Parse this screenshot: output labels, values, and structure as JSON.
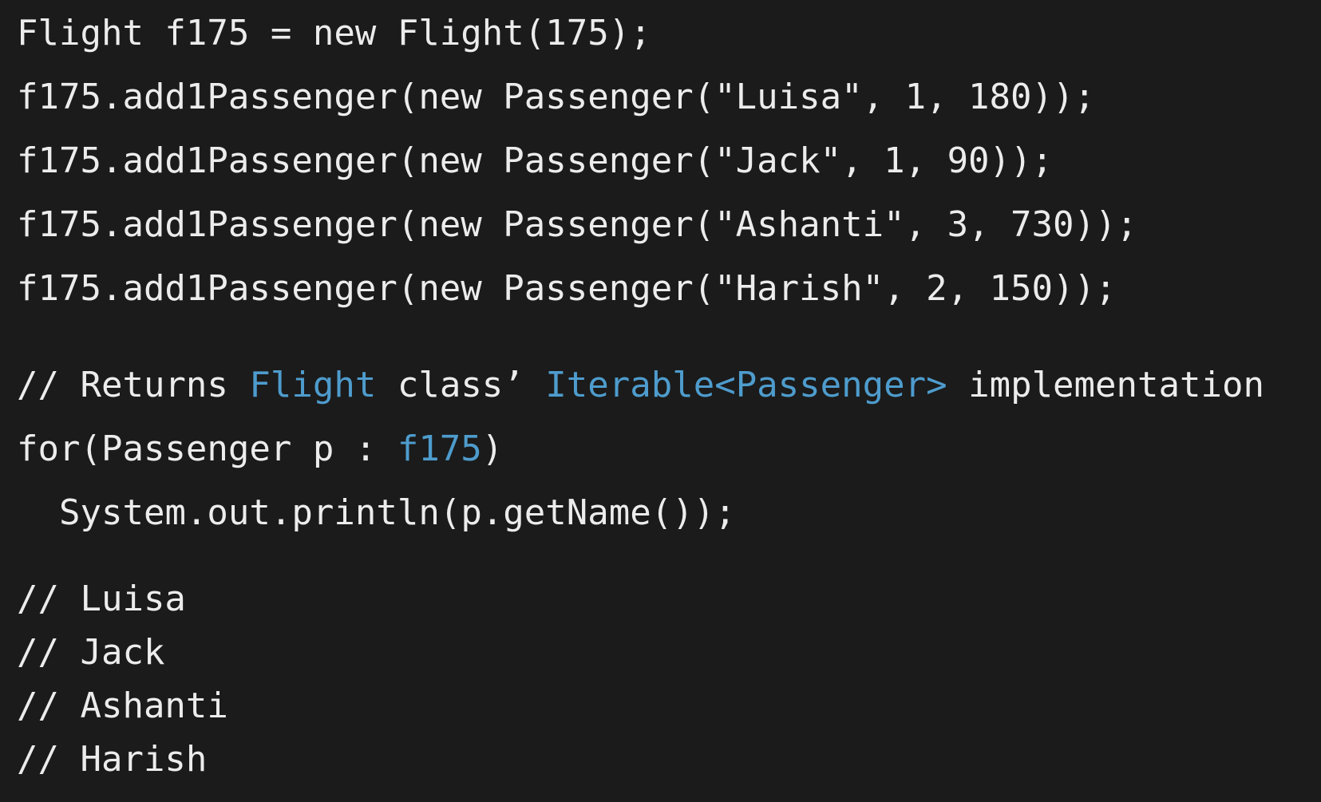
{
  "colors": {
    "background": "#1b1b1b",
    "text": "#ececec",
    "highlight": "#4e9ccd"
  },
  "code": {
    "line1": "Flight f175 = new Flight(175);",
    "line2": "f175.add1Passenger(new Passenger(\"Luisa\", 1, 180));",
    "line3": "f175.add1Passenger(new Passenger(\"Jack\", 1, 90));",
    "line4": "f175.add1Passenger(new Passenger(\"Ashanti\", 3, 730));",
    "line5": "f175.add1Passenger(new Passenger(\"Harish\", 2, 150));",
    "comment": {
      "part1": "// Returns ",
      "highlight1": "Flight",
      "part2": " class’ ",
      "highlight2": "Iterable<Passenger>",
      "part3": " implementation"
    },
    "for_loop": {
      "prefix": "for(Passenger p : ",
      "highlight": "f175",
      "suffix": ")"
    },
    "println": "System.out.println(p.getName());",
    "output": [
      "// Luisa",
      "// Jack",
      "// Ashanti",
      "// Harish"
    ]
  }
}
